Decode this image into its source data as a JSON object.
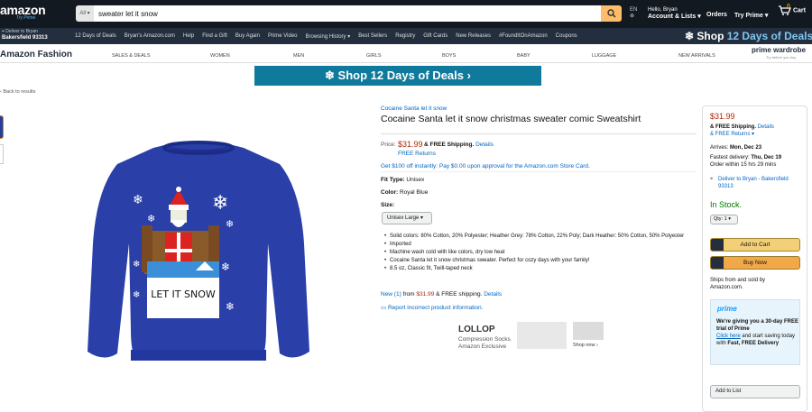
{
  "header": {
    "logo": "amazon",
    "logo_sub": "Try Prime",
    "search_category": "All",
    "search_value": "sweater let it snow",
    "lang": "EN",
    "greeting": "Hello, Bryan",
    "account": "Account & Lists",
    "orders": "Orders",
    "try_prime": "Try Prime",
    "cart": "Cart",
    "cart_count": "0"
  },
  "subnav": {
    "deliver_to": "Deliver to Bryan",
    "deliver_city": "Bakersfield 93313",
    "items": [
      "12 Days of Deals",
      "Bryan's Amazon.com",
      "Help",
      "Find a Gift",
      "Buy Again",
      "Prime Video",
      "Browsing History ▾",
      "Best Sellers",
      "Registry",
      "Gift Cards",
      "New Releases",
      "#FoundItOnAmazon",
      "Coupons"
    ],
    "promo_prefix": "Shop",
    "promo_highlight": "12 Days of Deals"
  },
  "fashion": {
    "title": "Amazon Fashion",
    "nav": [
      "SALES & DEALS",
      "WOMEN",
      "MEN",
      "GIRLS",
      "BOYS",
      "BABY",
      "LUGGAGE",
      "NEW ARRIVALS"
    ],
    "prime_wardrobe": "prime wardrobe",
    "prime_wardrobe_sub": "Try before you buy"
  },
  "banner": "❄  Shop 12 Days of Deals  ›",
  "back_link": "‹ Back to results",
  "product": {
    "brand": "Cocaine Santa let it snow",
    "title": "Cocaine Santa let it snow christmas sweater comic Sweatshirt",
    "image_text": "LET IT SNOW",
    "price_label": "Price:",
    "price": "$31.99",
    "shipping": "& FREE Shipping.",
    "details": "Details",
    "free_returns": "FREE Returns",
    "promo": "Get $100 off instantly: Pay $0.00 upon approval for the Amazon.com Store Card.",
    "fit_label": "Fit Type:",
    "fit_value": "Unisex",
    "color_label": "Color:",
    "color_value": "Royal Blue",
    "size_label": "Size:",
    "size_value": "Unisex Large",
    "bullets": [
      "Solid colors: 80% Cotton, 20% Polyester; Heather Grey: 78% Cotton, 22% Poly; Dark Heather: 50% Cotton, 50% Polyester",
      "Imported",
      "Machine wash cold with like colors, dry low heat",
      "Cocaine Santa let it snow christmas sweater. Perfect for cozy days with your family!",
      "8.5 oz, Classic fit, Twill-taped neck"
    ],
    "new_offer_link": "New (1)",
    "new_offer_rest": " from ",
    "new_offer_price": "$31.99",
    "new_offer_ship": " & FREE shipping.",
    "new_offer_details": "Details",
    "report": "Report incorrect product information."
  },
  "ad": {
    "brand": "LOLLOP",
    "line1": "Compression Socks",
    "line2": "Amazon Exclusive",
    "shop_now": "Shop now ›"
  },
  "buybox": {
    "price": "$31.99",
    "free_shipping": "& FREE Shipping.",
    "details": "Details",
    "free_returns": "& FREE Returns ▾",
    "arrives_label": "Arrives:",
    "arrives_date": "Mon, Dec 23",
    "fastest_label": "Fastest delivery:",
    "fastest_date": "Thu, Dec 19",
    "order_within": "Order within 15 hrs 29 mins",
    "deliver_to": "Deliver to Bryan - Bakersfield 93313",
    "in_stock": "In Stock.",
    "qty": "Qty: 1 ▾",
    "add_to_cart": "Add to Cart",
    "buy_now": "Buy Now",
    "ships_from": "Ships from and sold by",
    "seller": "Amazon.com.",
    "prime_logo": "prime",
    "prime_line1": "We're giving you a 30-day FREE trial of Prime",
    "prime_click": "Click here",
    "prime_line2": " and start saving today with ",
    "prime_line3": "Fast, FREE Delivery",
    "add_to_list": "Add to List"
  }
}
